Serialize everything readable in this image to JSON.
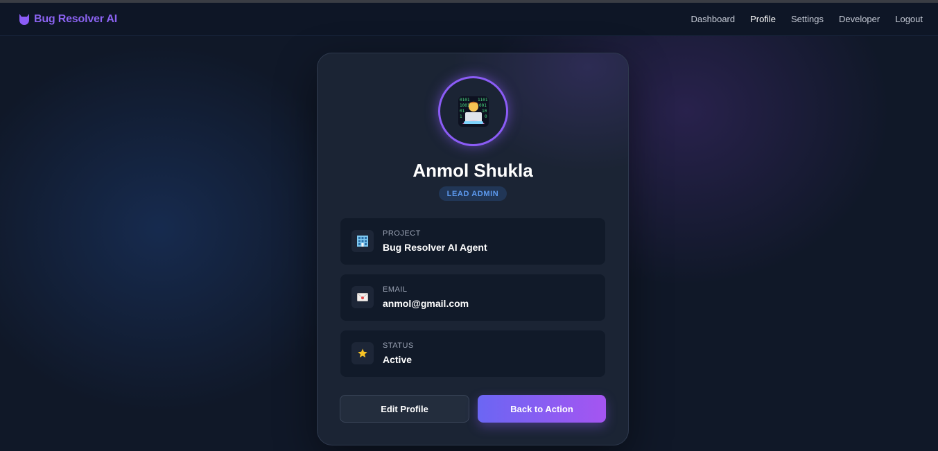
{
  "navbar": {
    "brand": "Bug Resolver AI",
    "links": [
      "Dashboard",
      "Profile",
      "Settings",
      "Developer",
      "Logout"
    ],
    "active": "Profile"
  },
  "profile": {
    "name": "Anmol Shukla",
    "role": "LEAD ADMIN",
    "avatar_icon": "technologist-icon"
  },
  "info": [
    {
      "label": "PROJECT",
      "value": "Bug Resolver AI Agent",
      "icon": "building-icon"
    },
    {
      "label": "EMAIL",
      "value": "anmol@gmail.com",
      "icon": "envelope-icon"
    },
    {
      "label": "STATUS",
      "value": "Active",
      "icon": "star-icon"
    }
  ],
  "buttons": {
    "edit": "Edit Profile",
    "back": "Back to Action"
  },
  "colors": {
    "accent": "#8b5cf6",
    "brand_text": "#8b63f1",
    "badge_text": "#5d9af0",
    "button_gradient_start": "#6b66f3",
    "button_gradient_end": "#a555f1"
  }
}
